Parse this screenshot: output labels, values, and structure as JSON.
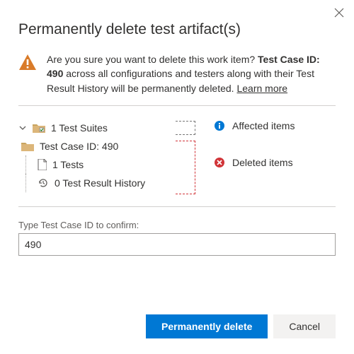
{
  "dialog": {
    "title": "Permanently delete test artifact(s)",
    "warning_pre": "Are you sure you want to delete this work item? ",
    "warning_bold": "Test Case ID: 490",
    "warning_post": " across all configurations and testers along with their Test Result History will be permanently deleted. ",
    "learn_more": "Learn more"
  },
  "tree": {
    "suites": "1 Test Suites",
    "case": "Test Case ID: 490",
    "tests": "1 Tests",
    "history": "0 Test Result History"
  },
  "legend": {
    "affected": "Affected items",
    "deleted": "Deleted items"
  },
  "confirm": {
    "label": "Type Test Case ID to confirm:",
    "value": "490"
  },
  "buttons": {
    "primary": "Permanently delete",
    "cancel": "Cancel"
  }
}
